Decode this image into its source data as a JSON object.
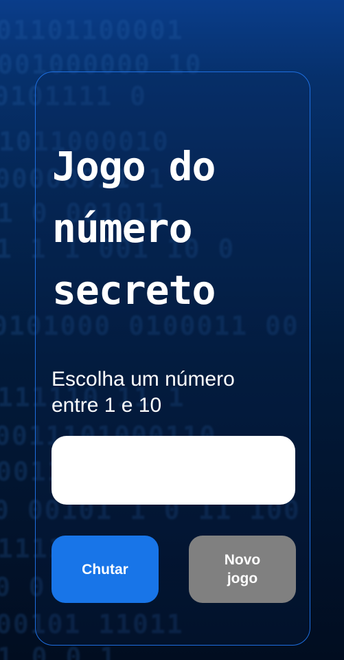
{
  "background": {
    "binary_lines": [
      "01101100001",
      "001000000 10",
      "0101111 0",
      "1011000010",
      "00000011 1",
      "1 0 001011",
      "1 1 1 001 10 0",
      "0101000 0100011 00",
      "111110 11 1",
      "0011101000110",
      "001111 1",
      "0 00101 1 0 11 100",
      "1111011 1",
      "0 0 1 0 0",
      "00101 11011",
      "1 0 0 1"
    ]
  },
  "card": {
    "title": "Jogo do número secreto",
    "prompt": "Escolha um número entre 1 e 10",
    "input": {
      "value": "",
      "placeholder": ""
    },
    "buttons": {
      "guess_label": "Chutar",
      "new_game_label": "Novo jogo"
    }
  },
  "colors": {
    "card_border": "#1e6fe0",
    "guess_button": "#1875e8",
    "new_game_button": "#808080",
    "text": "#ffffff"
  }
}
